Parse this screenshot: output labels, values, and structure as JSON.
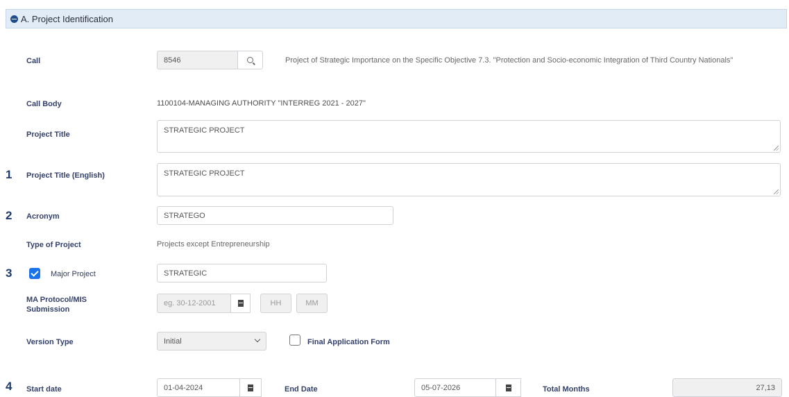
{
  "section": {
    "title": "A. Project Identification"
  },
  "call": {
    "label": "Call",
    "value": "8546",
    "description": "Project of Strategic Importance on the Specific Objective 7.3. \"Protection and Socio-economic Integration of Third Country Nationals\""
  },
  "call_body": {
    "label": "Call Body",
    "value": "1100104-MANAGING AUTHORITY \"INTERREG 2021 - 2027\""
  },
  "project_title": {
    "label": "Project Title",
    "value": "STRATEGIC PROJECT"
  },
  "project_title_en": {
    "number": "1",
    "label": "Project Title (English)",
    "value": "STRATEGIC PROJECT"
  },
  "acronym": {
    "number": "2",
    "label": "Acronym",
    "value": "STRATEGO"
  },
  "type_of_project": {
    "label": "Type of Project",
    "value": "Projects except Entrepreneurship"
  },
  "major_project": {
    "number": "3",
    "label": "Major Project",
    "checked": true,
    "value": "STRATEGIC"
  },
  "ma_protocol": {
    "label_line1": "MA Protocol/MIS",
    "label_line2": "Submission",
    "date_placeholder": "eg. 30-12-2001",
    "hh_placeholder": "HH",
    "mm_placeholder": "MM"
  },
  "version_type": {
    "label": "Version Type",
    "selected": "Initial"
  },
  "final_application": {
    "label": "Final Application Form",
    "checked": false
  },
  "dates": {
    "number": "4",
    "start_label": "Start date",
    "start_value": "01-04-2024",
    "end_label": "End Date",
    "end_value": "05-07-2026",
    "total_label": "Total Months",
    "total_value": "27,13"
  }
}
